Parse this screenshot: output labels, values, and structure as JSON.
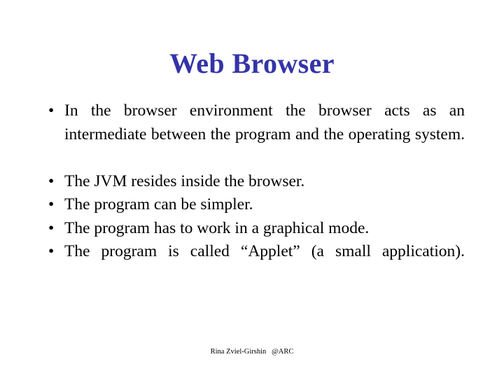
{
  "slide": {
    "title": "Web Browser",
    "title_color": "#3434a8",
    "background_color": "#ffffff",
    "text_color": "#000000",
    "bullet_glyph": "•",
    "bullets": [
      {
        "text": "In the browser environment the browser acts as an intermediate between the program and the operating system.",
        "justified": true
      },
      {
        "text": "The JVM resides inside the browser.",
        "justified": false
      },
      {
        "text": "The program can be simpler.",
        "justified": false
      },
      {
        "text": "The program has to work in a graphical mode.",
        "justified": false
      },
      {
        "text": "The program is called “Applet” (a small application).",
        "justified": true
      }
    ],
    "footer": "Rina Zviel-Girshin   @ARC"
  }
}
